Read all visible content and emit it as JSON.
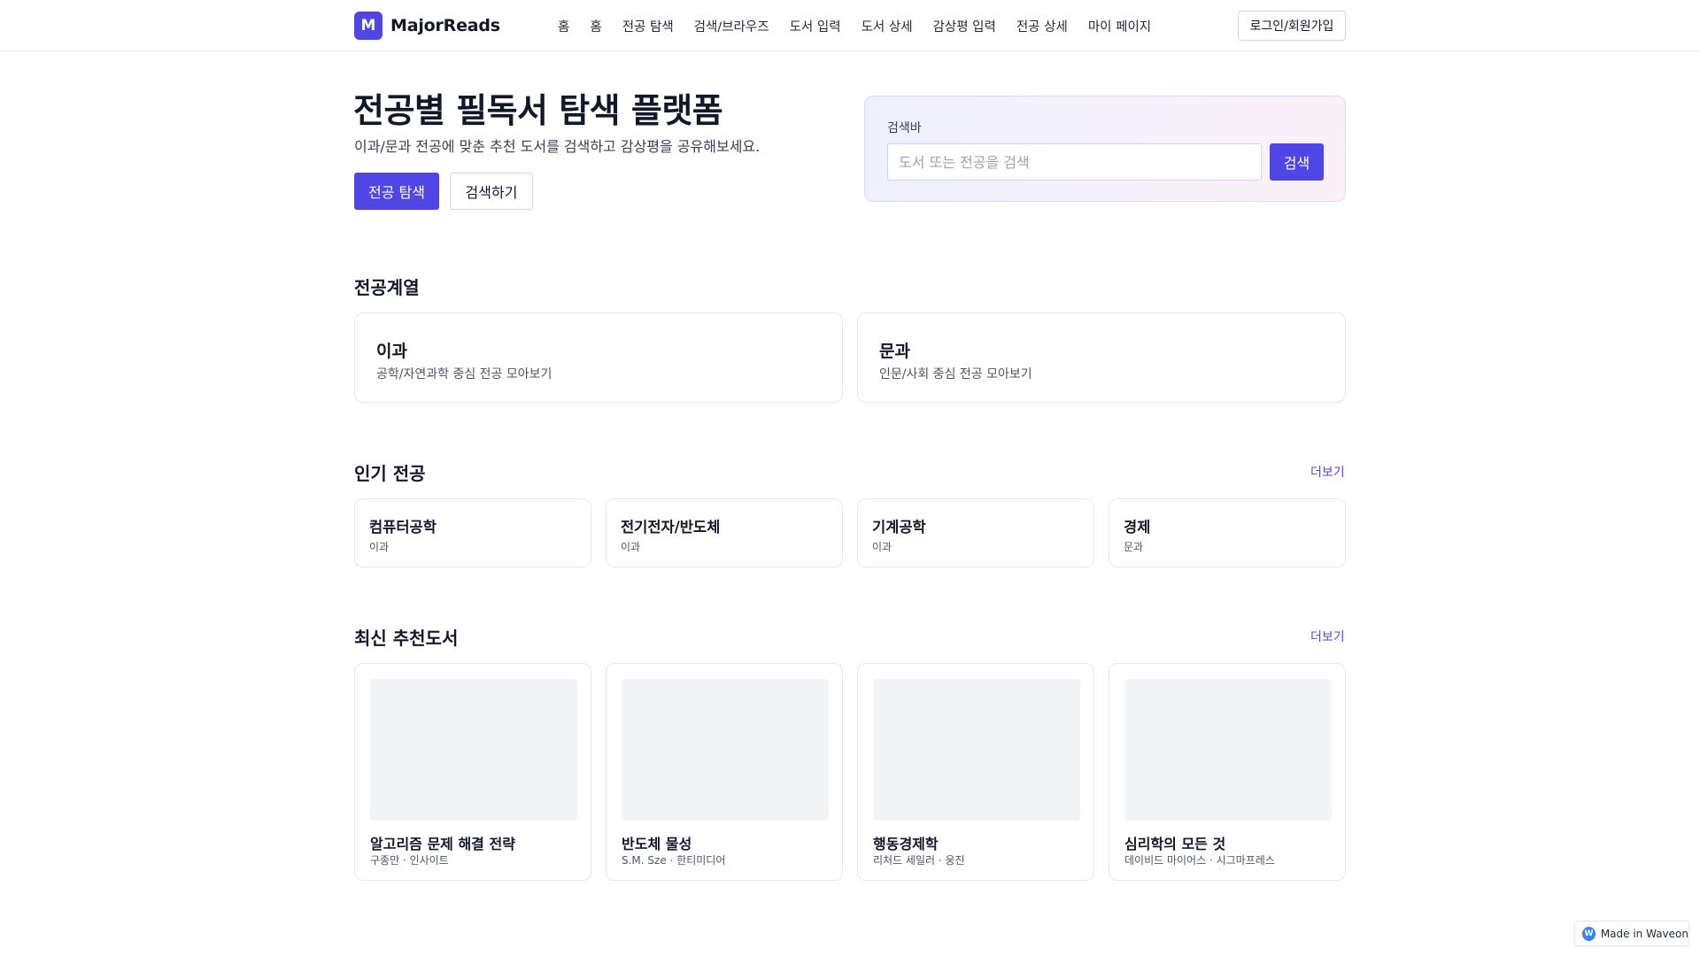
{
  "header": {
    "logo_letter": "M",
    "brand": "MajorReads",
    "nav": [
      "홈",
      "홈",
      "전공 탐색",
      "검색/브라우즈",
      "도서 입력",
      "도서 상세",
      "감상평 입력",
      "전공 상세",
      "마이 페이지"
    ],
    "login_label": "로그인/회원가입"
  },
  "hero": {
    "title": "전공별 필독서 탐색 플랫폼",
    "subtitle": "이과/문과 전공에 맞춘 추천 도서를 검색하고 감상평을 공유해보세요.",
    "primary_button": "전공 탐색",
    "secondary_button": "검색하기"
  },
  "search": {
    "label": "검색바",
    "placeholder": "도서 또는 전공을 검색",
    "value": "",
    "button": "검색"
  },
  "categories": {
    "title": "전공계열",
    "items": [
      {
        "name": "이과",
        "desc": "공학/자연과학 중심 전공 모아보기"
      },
      {
        "name": "문과",
        "desc": "인문/사회 중심 전공 모아보기"
      }
    ]
  },
  "popular": {
    "title": "인기 전공",
    "more": "더보기",
    "items": [
      {
        "name": "컴퓨터공학",
        "field": "이과"
      },
      {
        "name": "전기전자/반도체",
        "field": "이과"
      },
      {
        "name": "기계공학",
        "field": "이과"
      },
      {
        "name": "경제",
        "field": "문과"
      }
    ]
  },
  "books": {
    "title": "최신 추천도서",
    "more": "더보기",
    "items": [
      {
        "title": "알고리즘 문제 해결 전략",
        "meta": "구종만 · 인사이트"
      },
      {
        "title": "반도체 물성",
        "meta": "S.M. Sze · 한티미디어"
      },
      {
        "title": "행동경제학",
        "meta": "리처드 세일러 · 웅진"
      },
      {
        "title": "심리학의 모든 것",
        "meta": "데이비드 마이어스 · 시그마프레스"
      }
    ]
  },
  "badge": {
    "icon_letter": "W",
    "text": "Made in Waveon"
  },
  "colors": {
    "accent": "#4f46e5",
    "border": "#e5e7eb",
    "cover": "#f3f4f6"
  }
}
